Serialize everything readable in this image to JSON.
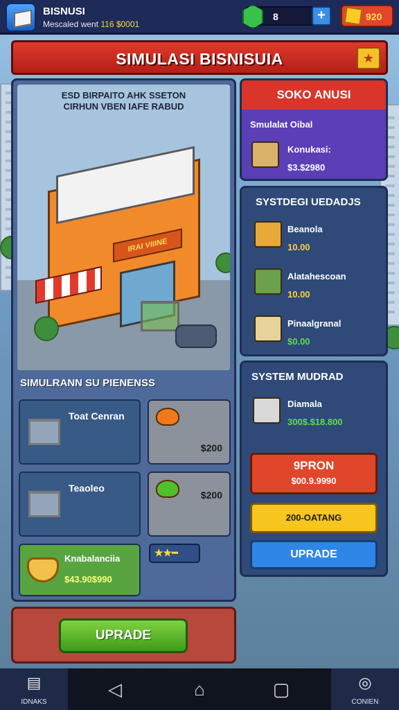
{
  "hud": {
    "title": "BISNUSI",
    "subtitle_prefix": "Mescaled went",
    "subtitle_value": "116 $0001",
    "gem_count": "8",
    "coin_value": "920",
    "plus_label": "+"
  },
  "banner": {
    "title": "SIMULASI BISNISUIA",
    "star_glyph": "★"
  },
  "scene": {
    "caption_line1": "ESD BIRPAITO AHK SSETON",
    "caption_line2": "CIRHUN VBEN IAFE RABUD",
    "shop_sign": "IRAI VIIINE"
  },
  "simulation": {
    "heading": "SIMULRANN SU PIENENSS",
    "items": [
      {
        "label": "Toat Cenran",
        "color": "#385a86"
      },
      {
        "label": "",
        "price": "$200",
        "color": "#8b929b"
      },
      {
        "label": "Teaoleo",
        "color": "#385a86"
      },
      {
        "label": "",
        "price": "$200",
        "color": "#8b929b"
      },
      {
        "label": "Knabalanciia",
        "price": "$43.90$990",
        "color": "#58a441"
      }
    ],
    "stars_bar": "★★━"
  },
  "left_upgrade": {
    "label": "UPRADE"
  },
  "right": {
    "soko": {
      "title": "SOKO ANUSI",
      "subtitle": "Smulalat Oibal",
      "item_label": "Konukasi:",
      "item_value": "$3.$2980"
    },
    "systemi": {
      "title": "SYSTDEGI UEDADJS",
      "items": [
        {
          "label": "Beanola",
          "value": "10.00"
        },
        {
          "label": "Alatahescoan",
          "value": "10.00"
        },
        {
          "label": "Pinaalgranal",
          "value": "$0.00"
        }
      ]
    },
    "system2": {
      "title": "SYSTEM MUDRAD",
      "item_label": "Diamala",
      "item_value": "300$.$18.800",
      "btn_red_title": "9PRON",
      "btn_red_value": "$00.9.9990",
      "btn_yellow": "200-OATANG",
      "btn_blue": "UPRADE"
    }
  },
  "navbar": {
    "left_label": "IDNAKS",
    "right_label": "CONIEN",
    "back_glyph": "◁",
    "home_glyph": "⌂",
    "recent_glyph": "▢"
  },
  "colors": {
    "hud_bg": "#1e2a57",
    "banner_red": "#e03a2c",
    "soko_header": "#d9352a",
    "soko_body": "#5b3fb6",
    "panel_blue": "#2f4a78",
    "green_btn": "#4fb82a",
    "red_btn": "#e0462a",
    "yellow_btn": "#f7c61e",
    "blue_btn": "#2f86e6"
  }
}
